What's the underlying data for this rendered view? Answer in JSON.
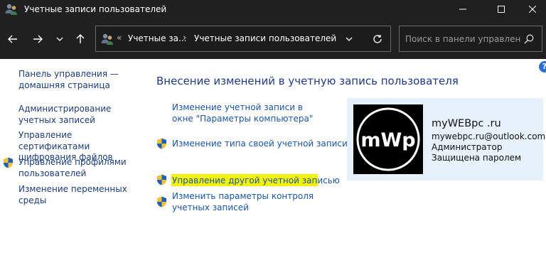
{
  "window": {
    "title": "Учетные записи пользователей"
  },
  "address": {
    "prefix": "«",
    "crumbs": [
      "Учетные за...",
      "Учетные записи пользователей"
    ],
    "separator": "›"
  },
  "search": {
    "placeholder": "Поиск в панели управления"
  },
  "help": {
    "label": "?"
  },
  "sidebar": {
    "items": [
      {
        "label": "Панель управления — домашняя страница",
        "shield": false
      },
      {
        "label": "Администрирование учетных записей",
        "shield": false
      },
      {
        "label": "Управление сертификатами шифрования файлов",
        "shield": false
      },
      {
        "label": "Управление профилями пользователей",
        "shield": true
      },
      {
        "label": "Изменение переменных среды",
        "shield": false
      }
    ]
  },
  "main": {
    "title": "Внесение изменений в учетную запись пользователя",
    "tasks": [
      {
        "label": "Изменение учетной записи в окне \"Параметры компьютера\"",
        "shield": false
      },
      {
        "label": "Изменение типа своей учетной записи",
        "shield": true
      },
      {
        "label": "Управление другой учетной записью",
        "shield": true,
        "highlighted": true
      },
      {
        "label": "Изменить параметры контроля учетных записей",
        "shield": true
      }
    ]
  },
  "user": {
    "avatar_text": "mWp",
    "name": "myWEBpc .ru",
    "email": "mywebpc.ru@outlook.com",
    "role": "Администратор",
    "password_status": "Защищена паролем"
  },
  "colors": {
    "titlebar_bg": "#202020",
    "link": "#1a56a8",
    "heading": "#1e3a8a",
    "highlight": "#f4f20a",
    "user_card_bg": "#e6f1fb"
  }
}
